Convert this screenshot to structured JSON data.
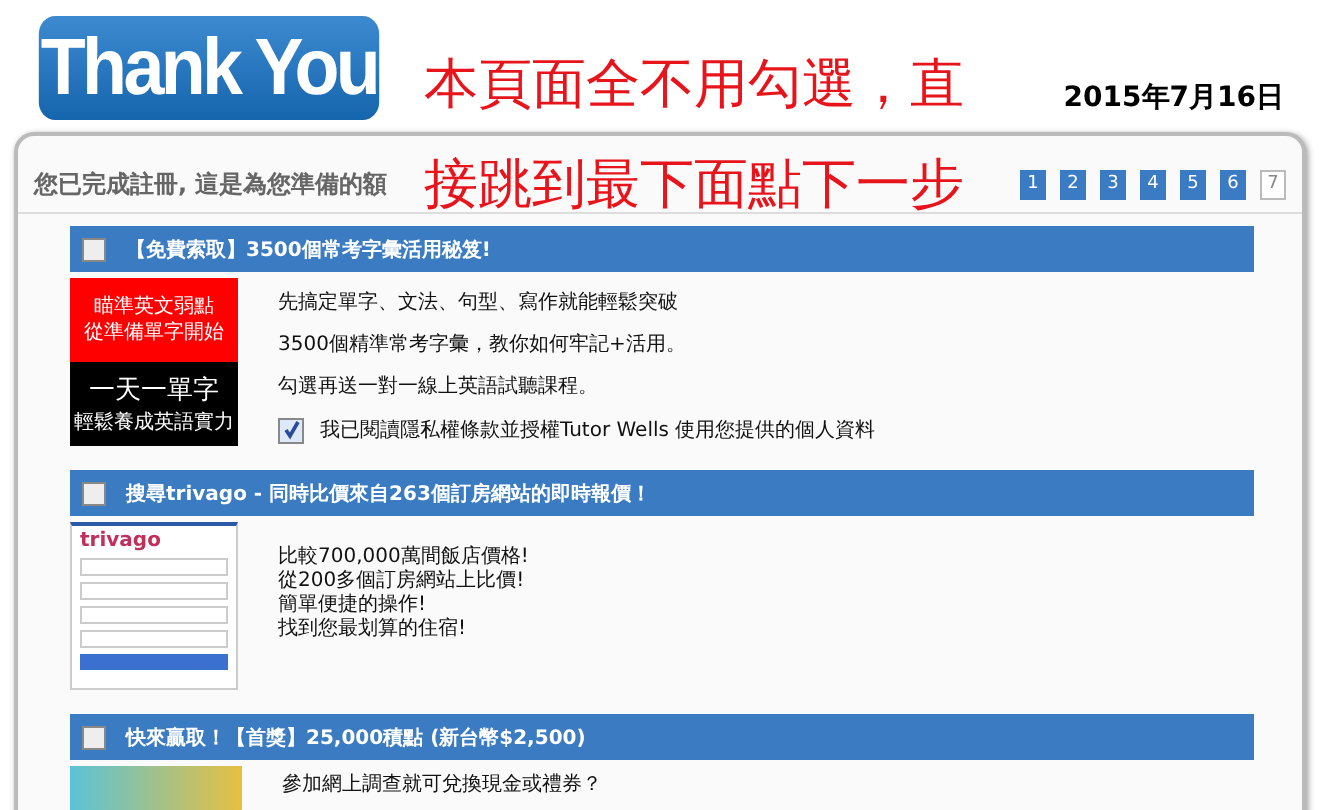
{
  "logo": {
    "text": "Thank You"
  },
  "annotation": {
    "lines": [
      "本頁面全不用勾選，直",
      "接跳到最下面點下一步"
    ]
  },
  "date": "2015年7月16日",
  "heading": "您已完成註冊, 這是為您準備的額",
  "steps": [
    {
      "label": "1",
      "completed": true
    },
    {
      "label": "2",
      "completed": true
    },
    {
      "label": "3",
      "completed": true
    },
    {
      "label": "4",
      "completed": true
    },
    {
      "label": "5",
      "completed": true
    },
    {
      "label": "6",
      "completed": true
    },
    {
      "label": "7",
      "completed": false
    }
  ],
  "offers": [
    {
      "kind": "banner",
      "checked": false,
      "title": "【免費索取】3500個常考字彙活用秘笈!",
      "banner": {
        "top": [
          "瞄準英文弱點",
          "從準備單字開始"
        ],
        "big": "一天一單字",
        "small": "輕鬆養成英語實力"
      },
      "lines": [
        "先搞定單字、文法、句型、寫作就能輕鬆突破",
        "3500個精準常考字彙，教你如何牢記+活用。",
        "勾選再送一對一線上英語試聽課程。"
      ],
      "consent": {
        "checked": true,
        "text": "我已閱讀隱私權條款並授權Tutor Wells 使用您提供的個人資料"
      }
    },
    {
      "kind": "search",
      "checked": false,
      "title": "搜尋trivago - 同時比價來自263個訂房網站的即時報價！",
      "brand": "trivago",
      "lines": [
        "比較700,000萬間飯店價格!",
        "從200多個訂房網站上比價!",
        "簡單便捷的操作!",
        "找到您最划算的住宿!"
      ]
    },
    {
      "kind": "photo",
      "checked": false,
      "title": "快來贏取！【首獎】25,000積點 (新台幣$2,500)",
      "lines": [
        "參加網上調查就可兌換現金或禮券？"
      ]
    }
  ]
}
